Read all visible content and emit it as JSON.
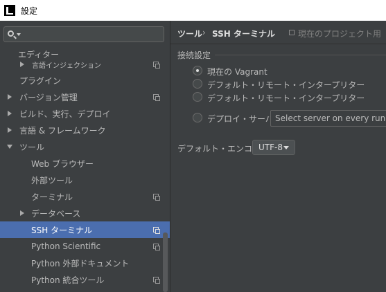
{
  "window": {
    "title": "設定"
  },
  "search": {
    "placeholder": "",
    "value": ""
  },
  "tree": {
    "items": [
      {
        "label": "エディター"
      },
      {
        "label": "言語インジェクション"
      },
      {
        "label": "プラグイン"
      },
      {
        "label": "バージョン管理"
      },
      {
        "label": "ビルド、実行、デプロイ"
      },
      {
        "label": "言語 & フレームワーク"
      },
      {
        "label": "ツール"
      },
      {
        "label": "Web ブラウザー"
      },
      {
        "label": "外部ツール"
      },
      {
        "label": "ターミナル"
      },
      {
        "label": "データベース"
      },
      {
        "label": "SSH ターミナル"
      },
      {
        "label": "Python Scientific"
      },
      {
        "label": "Python 外部ドキュメント"
      },
      {
        "label": "Python 統合ツール"
      }
    ]
  },
  "breadcrumb": {
    "parent": "ツール",
    "separator": "›",
    "current": "SSH ターミナル",
    "scope": "現在のプロジェクト用"
  },
  "connection": {
    "section_title": "接続設定",
    "options": [
      {
        "label": "現在の Vagrant",
        "checked": true
      },
      {
        "label": "デフォルト・リモート・インタープリター",
        "checked": false
      },
      {
        "label": "デフォルト・リモート・インタープリター",
        "checked": false
      },
      {
        "label": "デプロイ・サーバー",
        "checked": false
      }
    ],
    "server_select_value": "Select server on every run"
  },
  "encoding": {
    "label": "デフォルト・エンコード:",
    "value": "UTF-8"
  },
  "colors": {
    "background": "#3c3f41",
    "selection": "#4b6eaf",
    "text": "#bbbbbb"
  }
}
